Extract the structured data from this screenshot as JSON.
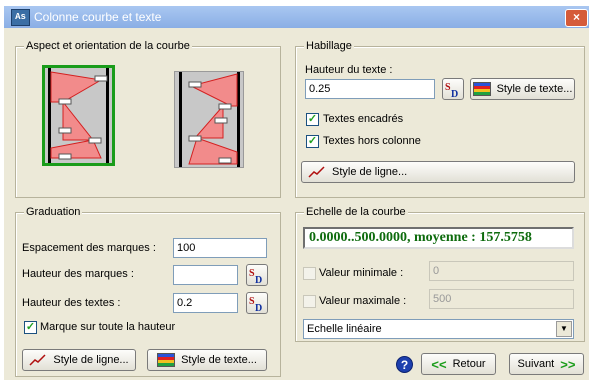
{
  "window": {
    "title": "Colonne courbe et texte",
    "app_icon": "As",
    "close_glyph": "×"
  },
  "aspect": {
    "title": "Aspect et orientation de la courbe"
  },
  "habillage": {
    "title": "Habillage",
    "hauteur_label": "Hauteur du texte :",
    "hauteur_value": "0.25",
    "style_texte": "Style de texte...",
    "encadres_label": "Textes encadrés",
    "encadres_checked": true,
    "hors_colonne_label": "Textes hors colonne",
    "hors_colonne_checked": true,
    "style_ligne": "Style de ligne..."
  },
  "graduation": {
    "title": "Graduation",
    "espacement_label": "Espacement des marques :",
    "espacement_value": "100",
    "hauteur_marques_label": "Hauteur des marques :",
    "hauteur_marques_value": "",
    "hauteur_textes_label": "Hauteur des textes :",
    "hauteur_textes_value": "0.2",
    "marque_label": "Marque sur toute la hauteur",
    "marque_checked": true,
    "style_ligne": "Style de ligne...",
    "style_texte": "Style de texte..."
  },
  "echelle": {
    "title": "Echelle de la courbe",
    "display": "0.0000..500.0000, moyenne : 157.5758",
    "display_color": "#0d6b0d",
    "valeur_min_label": "Valeur minimale :",
    "valeur_min_value": "0",
    "valeur_max_label": "Valeur maximale :",
    "valeur_max_value": "500",
    "echelle_type": "Echelle linéaire"
  },
  "footer": {
    "help": "?",
    "retour": "Retour",
    "suivant": "Suivant"
  },
  "colors": {
    "accent_green": "#1a9c1a",
    "shape_fill": "#f28b8b",
    "shape_stroke": "#d42020"
  }
}
